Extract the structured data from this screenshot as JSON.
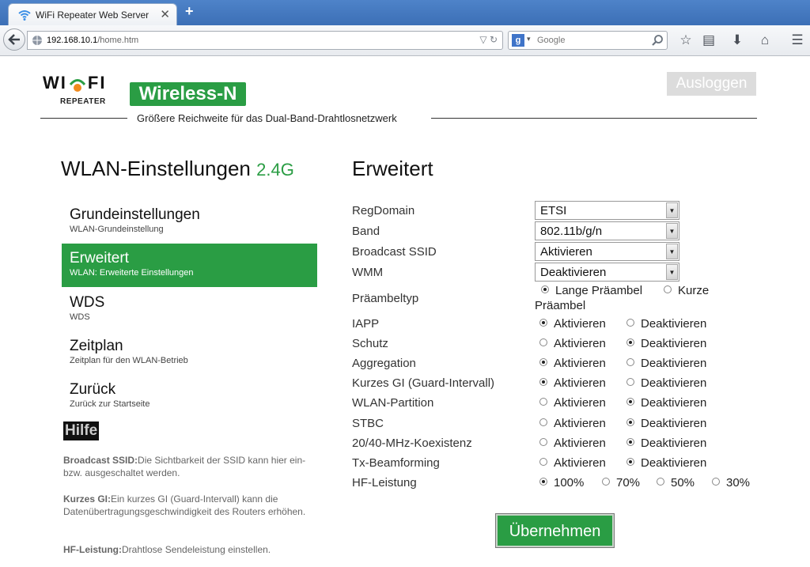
{
  "browser": {
    "tab_title": "WiFi Repeater Web Server",
    "url_host": "192.168.10.1",
    "url_path": "/home.htm",
    "search_placeholder": "Google",
    "search_engine_icon": "google-g-icon"
  },
  "header": {
    "logo_text_left": "WI",
    "logo_text_right": "FI",
    "logo_sub": "REPEATER",
    "badge": "Wireless-N",
    "logout_label": "Ausloggen",
    "tagline": "Größere Reichweite für das Dual-Band-Drahtlosnetzwerk"
  },
  "sidebar": {
    "heading": "WLAN-Einstellungen",
    "heading_band": "2.4G",
    "items": [
      {
        "title": "Grundeinstellungen",
        "subtitle": "WLAN-Grundeinstellung"
      },
      {
        "title": "Erweitert",
        "subtitle": "WLAN: Erweiterte Einstellungen"
      },
      {
        "title": "WDS",
        "subtitle": "WDS"
      },
      {
        "title": "Zeitplan",
        "subtitle": "Zeitplan für den WLAN-Betrieb"
      },
      {
        "title": "Zurück",
        "subtitle": "Zurück zur Startseite"
      }
    ],
    "active_index": 1,
    "help_label": "Hilfe",
    "help": [
      {
        "term": "Broadcast SSID:",
        "text": "Die Sichtbarkeit der SSID kann hier ein- bzw. ausgeschaltet werden."
      },
      {
        "term": "Kurzes GI:",
        "text": "Ein kurzes GI (Guard-Intervall) kann die Datenübertragungsgeschwindigkeit des Routers erhöhen."
      },
      {
        "term": "HF-Leistung:",
        "text": "Drahtlose Sendeleistung einstellen."
      }
    ]
  },
  "main": {
    "heading": "Erweitert",
    "selects": [
      {
        "label": "RegDomain",
        "value": "ETSI"
      },
      {
        "label": "Band",
        "value": "802.11b/g/n"
      },
      {
        "label": "Broadcast SSID",
        "value": "Aktivieren"
      },
      {
        "label": "WMM",
        "value": "Deaktivieren"
      }
    ],
    "preamble": {
      "label": "Präambeltyp",
      "option_long": "Lange Präambel",
      "option_short_1": "Kurze",
      "option_short_2": "Präambel",
      "selected": "long"
    },
    "radios": [
      {
        "label": "IAPP",
        "selected": "on"
      },
      {
        "label": "Schutz",
        "selected": "off"
      },
      {
        "label": "Aggregation",
        "selected": "on"
      },
      {
        "label": "Kurzes GI (Guard-Intervall)",
        "selected": "on"
      },
      {
        "label": "WLAN-Partition",
        "selected": "off"
      },
      {
        "label": "STBC",
        "selected": "off"
      },
      {
        "label": "20/40-MHz-Koexistenz",
        "selected": "off"
      },
      {
        "label": "Tx-Beamforming",
        "selected": "off"
      }
    ],
    "on_label": "Aktivieren",
    "off_label": "Deaktivieren",
    "power": {
      "label": "HF-Leistung",
      "options": [
        "100%",
        "70%",
        "50%",
        "30%"
      ],
      "selected": "100%"
    },
    "apply_label": "Übernehmen"
  },
  "colors": {
    "brand_green": "#2a9d44"
  }
}
